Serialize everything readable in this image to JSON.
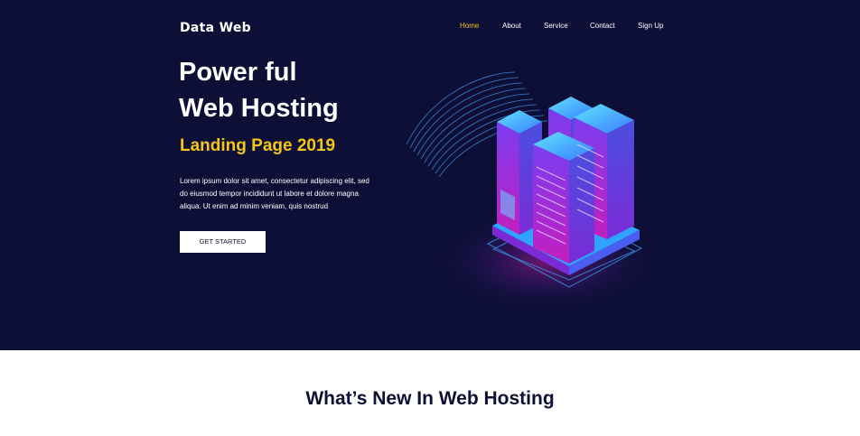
{
  "brand": {
    "name": "Data Web"
  },
  "nav": {
    "items": [
      {
        "label": "Home",
        "active": true
      },
      {
        "label": "About",
        "active": false
      },
      {
        "label": "Service",
        "active": false
      },
      {
        "label": "Contact",
        "active": false
      },
      {
        "label": "Sign Up",
        "active": false
      }
    ]
  },
  "hero": {
    "headline_line1": "Power ful",
    "headline_line2": "Web Hosting",
    "subheadline": "Landing Page 2019",
    "body_lines": [
      "Lorem ipsum dolor sit amet, consectetur adipiscing elit, sed",
      "do eiusmod tempor incididunt ut labore et dolore magna",
      "aliqua. Ut enim ad minim veniam, quis nostrud"
    ],
    "cta_label": "GET STARTED",
    "illustration_icon": "server-stack-icon"
  },
  "section": {
    "title": "What’s New In Web Hosting"
  },
  "colors": {
    "hero_bg": "#0e0f36",
    "accent": "#f5c518",
    "text_light": "#ffffff",
    "heading_dark": "#0e0f36"
  }
}
